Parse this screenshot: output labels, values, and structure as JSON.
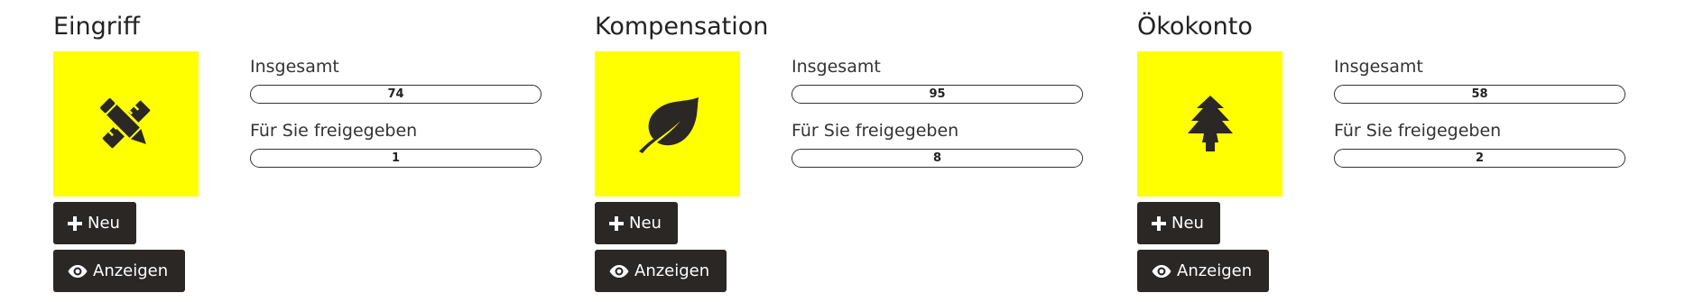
{
  "colors": {
    "tile_background": "#ffff00",
    "icon_color": "#2a2725",
    "button_background": "#2a2725",
    "button_text": "#ffffff"
  },
  "cards": [
    {
      "title": "Eingriff",
      "icon": "pencil-ruler-icon",
      "total_label": "Insgesamt",
      "total_value": "74",
      "shared_label": "Für Sie freigegeben",
      "shared_value": "1",
      "new_label": "Neu",
      "show_label": "Anzeigen"
    },
    {
      "title": "Kompensation",
      "icon": "leaf-icon",
      "total_label": "Insgesamt",
      "total_value": "95",
      "shared_label": "Für Sie freigegeben",
      "shared_value": "8",
      "new_label": "Neu",
      "show_label": "Anzeigen"
    },
    {
      "title": "Ökokonto",
      "icon": "tree-icon",
      "total_label": "Insgesamt",
      "total_value": "58",
      "shared_label": "Für Sie freigegeben",
      "shared_value": "2",
      "new_label": "Neu",
      "show_label": "Anzeigen"
    }
  ]
}
